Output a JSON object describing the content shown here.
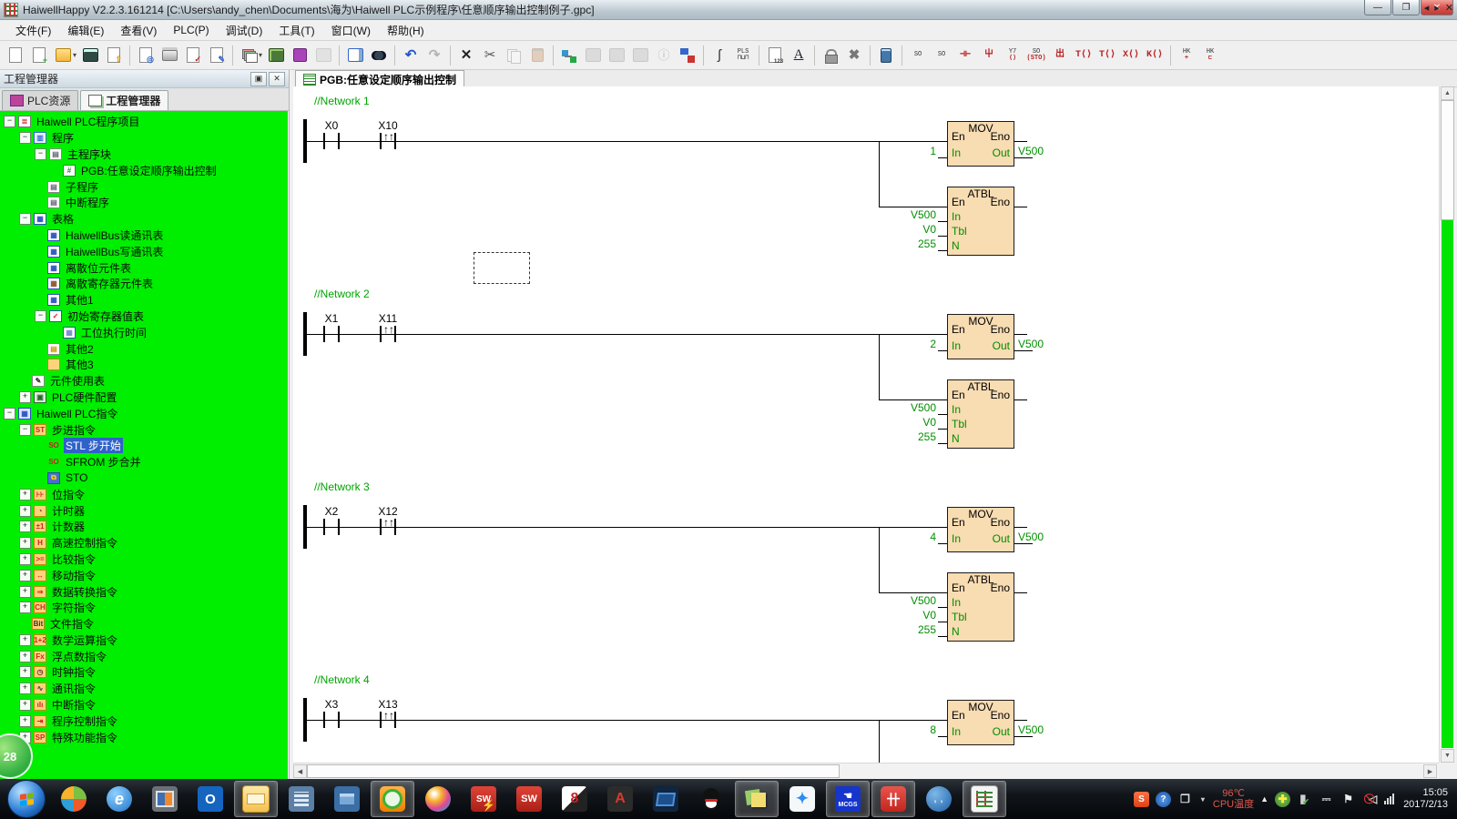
{
  "window": {
    "title": "HaiwellHappy V2.2.3.161214 [C:\\Users\\andy_chen\\Documents\\海为\\Haiwell PLC示例程序\\任意顺序输出控制例子.gpc]",
    "controls": {
      "minimize": "—",
      "restore": "❐",
      "close": "✕"
    }
  },
  "menu": {
    "items": [
      "文件(F)",
      "编辑(E)",
      "查看(V)",
      "PLC(P)",
      "调试(D)",
      "工具(T)",
      "窗口(W)",
      "帮助(H)"
    ]
  },
  "toolbar": {
    "groups": [
      [
        {
          "n": "new-file"
        },
        {
          "n": "new-project"
        },
        {
          "n": "open-file"
        },
        {
          "n": "open-dropdown",
          "caret": true
        },
        {
          "n": "save"
        },
        {
          "n": "import"
        }
      ],
      [
        {
          "n": "print-preview"
        },
        {
          "n": "print"
        },
        {
          "n": "check-program"
        },
        {
          "n": "edit-table"
        }
      ],
      [
        {
          "n": "compile"
        },
        {
          "n": "compile-dropdown",
          "caret": true
        },
        {
          "n": "hardware-config"
        },
        {
          "n": "plc-resource"
        },
        {
          "n": "comment",
          "dis": true
        }
      ],
      [
        {
          "n": "options"
        },
        {
          "n": "find"
        }
      ],
      [
        {
          "n": "undo"
        },
        {
          "n": "redo",
          "dis": true
        }
      ],
      [
        {
          "n": "delete"
        },
        {
          "n": "cut"
        },
        {
          "n": "copy",
          "dis": true
        },
        {
          "n": "paste",
          "dis": true
        }
      ],
      [
        {
          "n": "network-link"
        },
        {
          "n": "download",
          "dis": true
        },
        {
          "n": "upload",
          "dis": true
        },
        {
          "n": "compare",
          "dis": true
        },
        {
          "n": "info",
          "dis": true
        },
        {
          "n": "online-monitor"
        }
      ],
      [
        {
          "n": "probe"
        },
        {
          "n": "pls-trace"
        }
      ],
      [
        {
          "n": "element-list"
        },
        {
          "n": "font"
        }
      ],
      [
        {
          "n": "lock"
        },
        {
          "n": "stop-edit"
        }
      ],
      [
        {
          "n": "device"
        }
      ],
      [
        {
          "n": "stl-start",
          "label": "SO <STL>"
        },
        {
          "n": "stl-s",
          "label": "SO <S>"
        },
        {
          "n": "contact-no",
          "label": "⊣⊢"
        },
        {
          "n": "contact-vert",
          "label": "屮"
        },
        {
          "n": "coil-y7",
          "label": "Y7 ⟨⟩"
        },
        {
          "n": "stl-sto",
          "label": "SO (STO)"
        },
        {
          "n": "contact-h",
          "label": "出"
        },
        {
          "n": "coil-t",
          "label": "T⟨⟩"
        },
        {
          "n": "coil-t2",
          "label": "T⟨⟩"
        },
        {
          "n": "coil-x",
          "label": "X⟨⟩"
        },
        {
          "n": "coil-k",
          "label": "K⟨⟩"
        }
      ],
      [
        {
          "n": "hk-add",
          "label": "HK +"
        },
        {
          "n": "hk-edit",
          "label": "HK ⊏"
        }
      ]
    ]
  },
  "project_panel": {
    "title": "工程管理器",
    "header_buttons": {
      "pin": "✎",
      "close": "✕"
    },
    "tabs": [
      {
        "label": "PLC资源",
        "icon": "chip-icon",
        "active": false
      },
      {
        "label": "工程管理器",
        "icon": "stack-icon",
        "active": true
      }
    ],
    "tree": [
      {
        "d": 0,
        "e": "-",
        "i": "stack",
        "t": "Haiwell PLC程序项目"
      },
      {
        "d": 1,
        "e": "-",
        "i": "prog",
        "t": "程序"
      },
      {
        "d": 2,
        "e": "-",
        "i": "mainblk",
        "t": "主程序块"
      },
      {
        "d": 3,
        "e": "",
        "i": "pgb",
        "t": "PGB:任意设定顺序输出控制"
      },
      {
        "d": 2,
        "e": "",
        "i": "subprog",
        "t": "子程序"
      },
      {
        "d": 2,
        "e": "",
        "i": "subprog",
        "t": "中断程序"
      },
      {
        "d": 1,
        "e": "-",
        "i": "table",
        "t": "表格"
      },
      {
        "d": 2,
        "e": "",
        "i": "tbl_r",
        "t": "HaiwellBus读通讯表"
      },
      {
        "d": 2,
        "e": "",
        "i": "tbl_w",
        "t": "HaiwellBus写通讯表"
      },
      {
        "d": 2,
        "e": "",
        "i": "tbl_b",
        "t": "离散位元件表"
      },
      {
        "d": 2,
        "e": "",
        "i": "tbl_p",
        "t": "离散寄存器元件表"
      },
      {
        "d": 2,
        "e": "",
        "i": "tbl_1",
        "t": "其他1"
      },
      {
        "d": 2,
        "e": "-",
        "i": "tbl_chk",
        "t": "初始寄存器值表"
      },
      {
        "d": 3,
        "e": "",
        "i": "tbl_sub",
        "t": "工位执行时间"
      },
      {
        "d": 2,
        "e": "",
        "i": "page_y",
        "t": "其他2"
      },
      {
        "d": 2,
        "e": "",
        "i": "folder_o",
        "t": "其他3"
      },
      {
        "d": 1,
        "e": "",
        "i": "usage",
        "t": "元件使用表"
      },
      {
        "d": 1,
        "e": "+",
        "i": "hw",
        "t": "PLC硬件配置"
      },
      {
        "d": 0,
        "e": "-",
        "i": "inst",
        "t": "Haiwell PLC指令"
      },
      {
        "d": 1,
        "e": "-",
        "i": "f_stl",
        "t": "步进指令"
      },
      {
        "d": 2,
        "e": "",
        "i": "i_stl",
        "t": "STL 步开始",
        "sel": true
      },
      {
        "d": 2,
        "e": "",
        "i": "i_sfrom",
        "t": "SFROM 步合并"
      },
      {
        "d": 2,
        "e": "",
        "i": "i_sto",
        "t": "STO"
      },
      {
        "d": 1,
        "e": "+",
        "i": "f_bit",
        "t": "位指令"
      },
      {
        "d": 1,
        "e": "+",
        "i": "f_tmr",
        "t": "计时器"
      },
      {
        "d": 1,
        "e": "+",
        "i": "f_cnt",
        "t": "计数器"
      },
      {
        "d": 1,
        "e": "+",
        "i": "f_hsc",
        "t": "高速控制指令"
      },
      {
        "d": 1,
        "e": "+",
        "i": "f_cmp",
        "t": "比较指令"
      },
      {
        "d": 1,
        "e": "+",
        "i": "f_mov",
        "t": "移动指令"
      },
      {
        "d": 1,
        "e": "+",
        "i": "f_cnv",
        "t": "数据转换指令"
      },
      {
        "d": 1,
        "e": "+",
        "i": "f_chr",
        "t": "字符指令"
      },
      {
        "d": 1,
        "e": "",
        "i": "f_fil",
        "t": "文件指令"
      },
      {
        "d": 1,
        "e": "+",
        "i": "f_mth",
        "t": "数学运算指令"
      },
      {
        "d": 1,
        "e": "+",
        "i": "f_flt",
        "t": "浮点数指令"
      },
      {
        "d": 1,
        "e": "+",
        "i": "f_clk",
        "t": "时钟指令"
      },
      {
        "d": 1,
        "e": "+",
        "i": "f_com",
        "t": "通讯指令"
      },
      {
        "d": 1,
        "e": "+",
        "i": "f_int",
        "t": "中断指令"
      },
      {
        "d": 1,
        "e": "+",
        "i": "f_pgc",
        "t": "程序控制指令"
      },
      {
        "d": 1,
        "e": "+",
        "i": "f_spf",
        "t": "特殊功能指令"
      }
    ]
  },
  "editor": {
    "tab": {
      "label": "PGB:任意设定顺序输出控制"
    },
    "tab_nav": {
      "prev": "◂",
      "next": "▸",
      "close": "✕"
    },
    "has_selection_cursor": true,
    "networks": [
      {
        "comment": "//Network 1",
        "contacts": [
          {
            "label": "X0",
            "type": "no"
          },
          {
            "label": "X10",
            "type": "rising"
          }
        ],
        "mov": {
          "title": "MOV",
          "en": "En",
          "eno": "Eno",
          "in": "In",
          "out": "Out",
          "in_value": "1",
          "out_value": "V500"
        },
        "atbl": {
          "title": "ATBL",
          "en": "En",
          "eno": "Eno",
          "rows": [
            {
              "pin": "In",
              "value": "V500"
            },
            {
              "pin": "Tbl",
              "value": "V0"
            },
            {
              "pin": "N",
              "value": "255"
            }
          ]
        }
      },
      {
        "comment": "//Network 2",
        "contacts": [
          {
            "label": "X1",
            "type": "no"
          },
          {
            "label": "X11",
            "type": "rising"
          }
        ],
        "mov": {
          "title": "MOV",
          "en": "En",
          "eno": "Eno",
          "in": "In",
          "out": "Out",
          "in_value": "2",
          "out_value": "V500"
        },
        "atbl": {
          "title": "ATBL",
          "en": "En",
          "eno": "Eno",
          "rows": [
            {
              "pin": "In",
              "value": "V500"
            },
            {
              "pin": "Tbl",
              "value": "V0"
            },
            {
              "pin": "N",
              "value": "255"
            }
          ]
        }
      },
      {
        "comment": "//Network 3",
        "contacts": [
          {
            "label": "X2",
            "type": "no"
          },
          {
            "label": "X12",
            "type": "rising"
          }
        ],
        "mov": {
          "title": "MOV",
          "en": "En",
          "eno": "Eno",
          "in": "In",
          "out": "Out",
          "in_value": "4",
          "out_value": "V500"
        },
        "atbl": {
          "title": "ATBL",
          "en": "En",
          "eno": "Eno",
          "rows": [
            {
              "pin": "In",
              "value": "V500"
            },
            {
              "pin": "Tbl",
              "value": "V0"
            },
            {
              "pin": "N",
              "value": "255"
            }
          ]
        }
      },
      {
        "comment": "//Network 4",
        "contacts": [
          {
            "label": "X3",
            "type": "no"
          },
          {
            "label": "X13",
            "type": "rising"
          }
        ],
        "mov": {
          "title": "MOV",
          "en": "En",
          "eno": "Eno",
          "in": "In",
          "out": "Out",
          "in_value": "8",
          "out_value": "V500"
        },
        "atbl": null
      }
    ]
  },
  "taskbar": {
    "apps": [
      {
        "name": "pinwheel",
        "active": false
      },
      {
        "name": "internet-explorer",
        "active": false
      },
      {
        "name": "vmware",
        "active": false
      },
      {
        "name": "outlook",
        "active": false
      },
      {
        "name": "file-explorer",
        "active": true
      },
      {
        "name": "calculator",
        "active": false
      },
      {
        "name": "system-panel",
        "active": false
      },
      {
        "name": "360-browser",
        "active": true
      },
      {
        "name": "media-sphere",
        "active": false
      },
      {
        "name": "solidworks-sim",
        "active": false
      },
      {
        "name": "solidworks",
        "active": false
      },
      {
        "name": "design-8",
        "active": false
      },
      {
        "name": "autocad",
        "active": false
      },
      {
        "name": "remote-window",
        "active": false
      },
      {
        "name": "qq",
        "active": false
      },
      {
        "name": "sticky-notes",
        "active": true
      },
      {
        "name": "blue-bird",
        "active": false
      },
      {
        "name": "mcgs",
        "active": true,
        "label": "MCGS"
      },
      {
        "name": "haiwell-tool",
        "active": true
      },
      {
        "name": "blue-face",
        "active": false
      },
      {
        "name": "haiwellhappy",
        "active": true
      }
    ],
    "tray": {
      "items": [
        {
          "name": "sogou"
        },
        {
          "name": "help"
        },
        {
          "name": "window-restore"
        },
        {
          "name": "dropdown"
        }
      ],
      "cpu_temp": {
        "line1": "96℃",
        "line2": "CPU温度"
      },
      "hidden_arrow": "▲",
      "items2": [
        {
          "name": "safe-shield"
        },
        {
          "name": "usb"
        },
        {
          "name": "power-plug"
        },
        {
          "name": "action-flag"
        },
        {
          "name": "speaker-muted"
        },
        {
          "name": "network-signal"
        }
      ]
    },
    "clock": {
      "time": "15:05",
      "date": "2017/2/13"
    }
  },
  "bubble": {
    "label": "28"
  },
  "colors": {
    "tree_bg": "#00ef00",
    "block_fill": "#f8dcb2",
    "ladder_green": "#008f00",
    "comment_green": "#00a300",
    "selection_blue": "#2f62c8",
    "close_red": "#d9544f"
  }
}
